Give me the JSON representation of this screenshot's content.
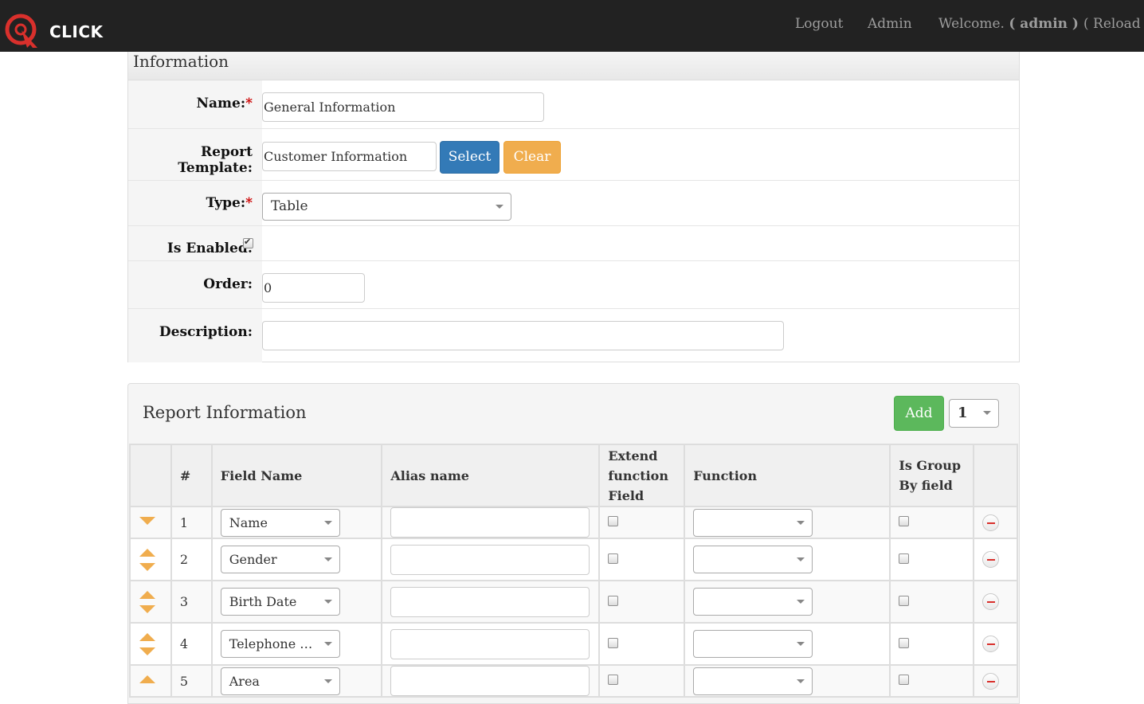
{
  "app": {
    "name": "CLICK"
  },
  "nav": {
    "logout": "Logout",
    "admin": "Admin",
    "welcome_prefix": "Welcome.",
    "welcome_user": "( admin )",
    "reload": "( Reload )"
  },
  "info_panel": {
    "title": "Information",
    "name_label": "Name:",
    "name_value": "General Information",
    "required_mark": "*",
    "template_label": "Report Template:",
    "template_value": "Customer Information",
    "select_button": "Select",
    "clear_button": "Clear",
    "type_label": "Type:",
    "type_value": "Table",
    "enabled_label": "Is Enabled:",
    "enabled": true,
    "order_label": "Order:",
    "order_value": "0",
    "description_label": "Description:",
    "description_value": ""
  },
  "report_panel": {
    "title": "Report Information",
    "add_button": "Add",
    "count_value": "1",
    "columns": {
      "move": "",
      "num": "#",
      "field": "Field Name",
      "alias": "Alias name",
      "extend": "Extend function Field",
      "function": "Function",
      "group": "Is Group By field",
      "remove": ""
    },
    "rows": [
      {
        "num": "1",
        "field": "Name",
        "alias": "",
        "extend": false,
        "function": "",
        "group": false
      },
      {
        "num": "2",
        "field": "Gender",
        "alias": "",
        "extend": false,
        "function": "",
        "group": false
      },
      {
        "num": "3",
        "field": "Birth Date",
        "alias": "",
        "extend": false,
        "function": "",
        "group": false
      },
      {
        "num": "4",
        "field": "Telephone Number",
        "alias": "",
        "extend": false,
        "function": "",
        "group": false
      },
      {
        "num": "5",
        "field": "Area",
        "alias": "",
        "extend": false,
        "function": "",
        "group": false
      }
    ]
  },
  "colors": {
    "navbar": "#222222",
    "logo_red": "#d9302c",
    "primary": "#337ab7",
    "warning": "#f0ad4e",
    "success": "#5cb85c",
    "danger": "#d9302c"
  }
}
